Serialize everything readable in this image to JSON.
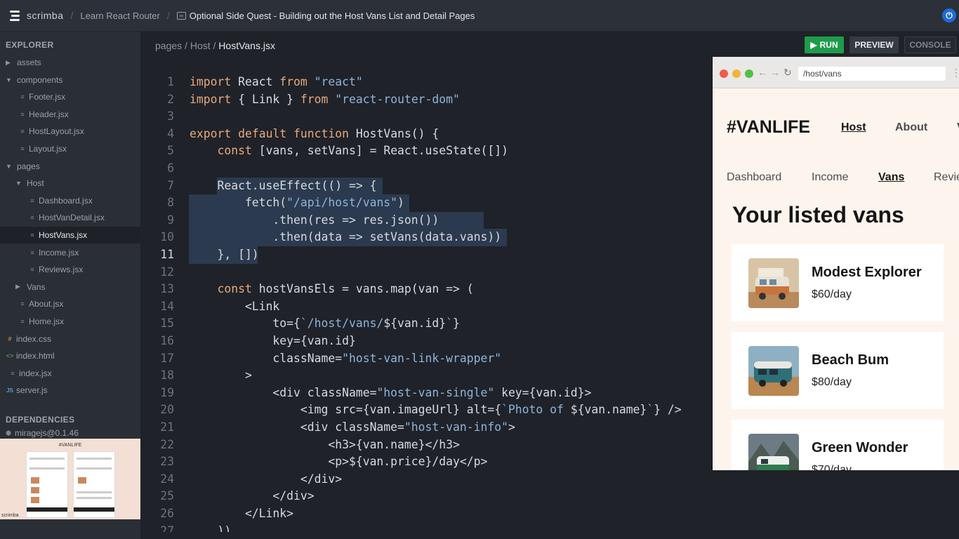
{
  "topbar": {
    "brand": "scrimba",
    "course": "Learn React Router",
    "lesson": "Optional Side Quest - Building out the Host Vans List and Detail Pages"
  },
  "sidebar": {
    "explorer_label": "EXPLORER",
    "dependencies_label": "DEPENDENCIES",
    "dependency": "miragejs@0.1.46",
    "items": [
      {
        "label": "assets",
        "kind": "folder",
        "open": false,
        "depth": 0
      },
      {
        "label": "components",
        "kind": "folder",
        "open": true,
        "depth": 0
      },
      {
        "label": "Footer.jsx",
        "kind": "file",
        "depth": 1
      },
      {
        "label": "Header.jsx",
        "kind": "file",
        "depth": 1
      },
      {
        "label": "HostLayout.jsx",
        "kind": "file",
        "depth": 1
      },
      {
        "label": "Layout.jsx",
        "kind": "file",
        "depth": 1
      },
      {
        "label": "pages",
        "kind": "folder",
        "open": true,
        "depth": 0
      },
      {
        "label": "Host",
        "kind": "folder",
        "open": true,
        "depth": 1
      },
      {
        "label": "Dashboard.jsx",
        "kind": "file",
        "depth": 2
      },
      {
        "label": "HostVanDetail.jsx",
        "kind": "file",
        "depth": 2
      },
      {
        "label": "HostVans.jsx",
        "kind": "file",
        "depth": 2,
        "active": true
      },
      {
        "label": "Income.jsx",
        "kind": "file",
        "depth": 2
      },
      {
        "label": "Reviews.jsx",
        "kind": "file",
        "depth": 2
      },
      {
        "label": "Vans",
        "kind": "folder",
        "open": false,
        "depth": 1
      },
      {
        "label": "About.jsx",
        "kind": "file",
        "depth": 1
      },
      {
        "label": "Home.jsx",
        "kind": "file",
        "depth": 1
      },
      {
        "label": "index.css",
        "kind": "css",
        "depth": 0
      },
      {
        "label": "index.html",
        "kind": "html",
        "depth": 0
      },
      {
        "label": "index.jsx",
        "kind": "file",
        "depth": 0
      },
      {
        "label": "server.js",
        "kind": "js",
        "depth": 0
      }
    ],
    "thumbnail_title": "#VANLIFE",
    "thumbnail_logo": "scrimba"
  },
  "editor": {
    "path_1": "pages",
    "path_2": "Host",
    "path_3": "HostVans.jsx",
    "current_line": 11,
    "lines": [
      "import React from \"react\"",
      "import { Link } from \"react-router-dom\"",
      "",
      "export default function HostVans() {",
      "    const [vans, setVans] = React.useState([])",
      "",
      "    React.useEffect(() => {",
      "        fetch(\"/api/host/vans\")",
      "            .then(res => res.json())",
      "            .then(data => setVans(data.vans))",
      "    }, [])",
      "",
      "    const hostVansEls = vans.map(van => (",
      "        <Link",
      "            to={`/host/vans/${van.id}`}",
      "            key={van.id}",
      "            className=\"host-van-link-wrapper\"",
      "        >",
      "            <div className=\"host-van-single\" key={van.id}>",
      "                <img src={van.imageUrl} alt={`Photo of ${van.name}`} />",
      "                <div className=\"host-van-info\">",
      "                    <h3>{van.name}</h3>",
      "                    <p>${van.price}/day</p>",
      "                </div>",
      "            </div>",
      "        </Link>",
      "    ))"
    ]
  },
  "toolbar": {
    "run": "RUN",
    "preview": "PREVIEW",
    "console": "CONSOLE"
  },
  "preview": {
    "url": "/host/vans",
    "site_logo": "#VANLIFE",
    "nav_main": [
      "Host",
      "About"
    ],
    "nav_sub": [
      "Dashboard",
      "Income",
      "Vans",
      "Reviews"
    ],
    "heading": "Your listed vans",
    "vans": [
      {
        "name": "Modest Explorer",
        "price": "$60/day"
      },
      {
        "name": "Beach Bum",
        "price": "$80/day"
      },
      {
        "name": "Green Wonder",
        "price": "$70/day"
      }
    ]
  },
  "colors": {
    "keyword": "#e8a97b",
    "string": "#8fb4d9",
    "run_green": "#1e9c4b",
    "selection": "#2b3a4e"
  }
}
